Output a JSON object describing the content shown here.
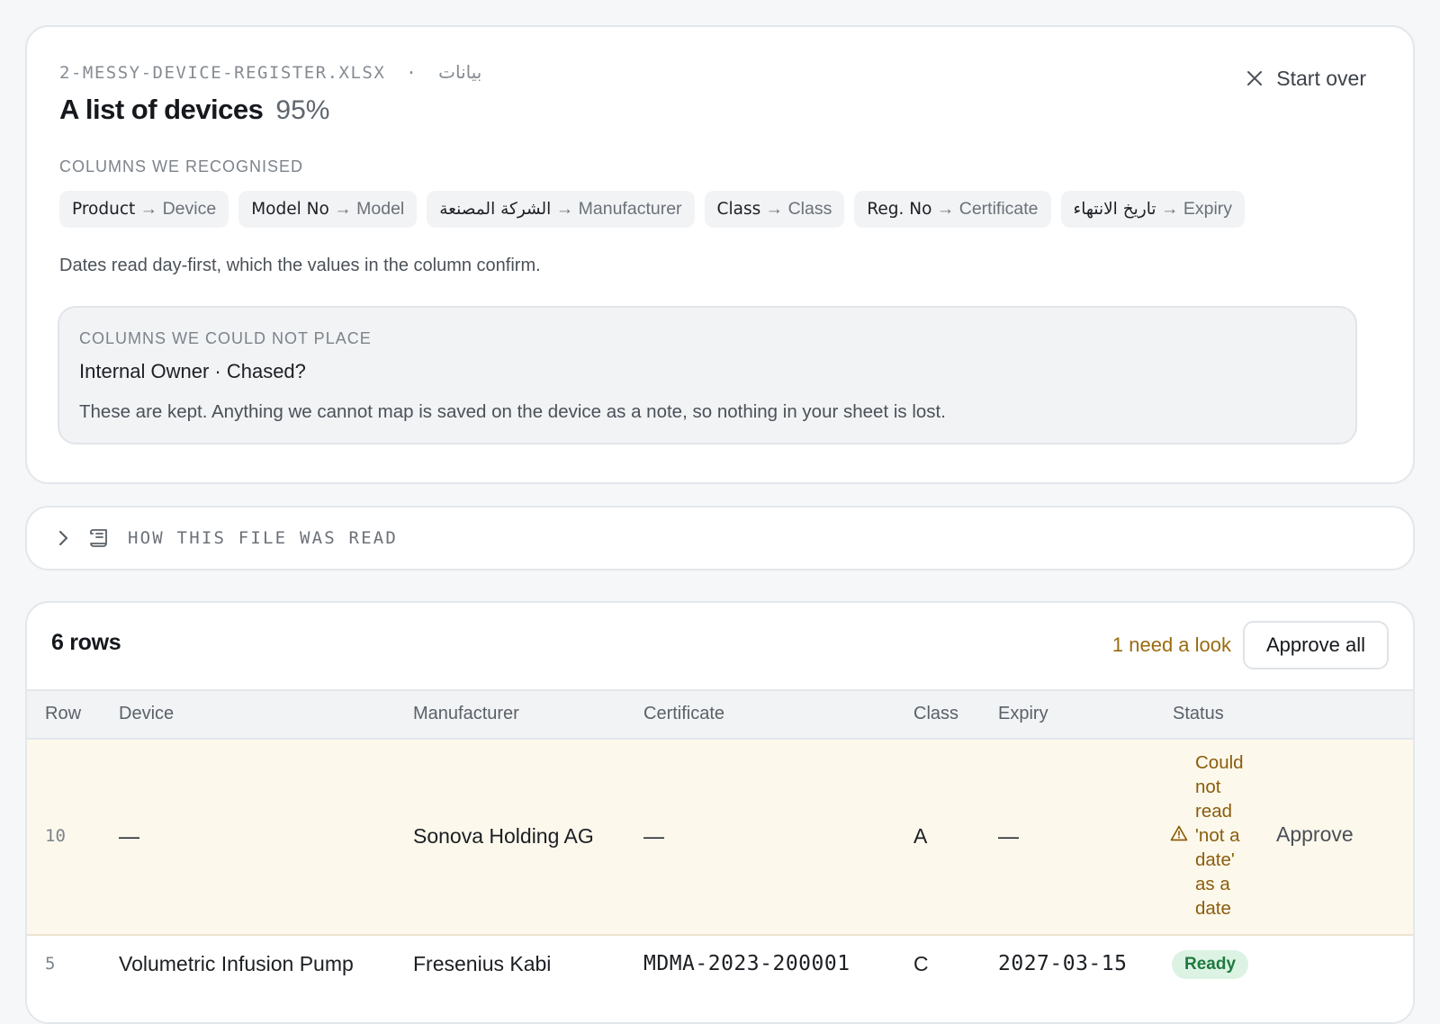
{
  "summary": {
    "file_name": "2-MESSY-DEVICE-REGISTER.XLSX",
    "separator": "·",
    "sheet_name": "بيانات",
    "title": "A list of devices",
    "confidence": "95%",
    "start_over_label": "Start over",
    "recognised_label": "COLUMNS WE RECOGNISED",
    "mappings": [
      {
        "source": "Product",
        "arrow": "→",
        "target": "Device"
      },
      {
        "source": "Model No",
        "arrow": "→",
        "target": "Model"
      },
      {
        "source": "الشركة المصنعة",
        "arrow": "→",
        "target": "Manufacturer"
      },
      {
        "source": "Class",
        "arrow": "→",
        "target": "Class"
      },
      {
        "source": "Reg. No",
        "arrow": "→",
        "target": "Certificate"
      },
      {
        "source": "تاريخ الانتهاء",
        "arrow": "→",
        "target": "Expiry"
      }
    ],
    "date_note": "Dates read day-first, which the values in the column confirm.",
    "unplaced_label": "COLUMNS WE COULD NOT PLACE",
    "unplaced_columns": "Internal Owner · Chased?",
    "unplaced_note": "These are kept. Anything we cannot map is saved on the device as a note, so nothing in your sheet is lost."
  },
  "how_read": {
    "label": "HOW THIS FILE WAS READ",
    "icons": {
      "toggle": "chevron-right-icon",
      "doc": "scroll-icon"
    }
  },
  "table": {
    "row_count": "6 rows",
    "need_look": "1 need a look",
    "approve_all_label": "Approve all",
    "headers": [
      "Row",
      "Device",
      "Manufacturer",
      "Certificate",
      "Class",
      "Expiry",
      "Status"
    ],
    "rows": [
      {
        "row": "10",
        "device": "—",
        "manufacturer": "Sonova Holding AG",
        "certificate": "—",
        "class": "A",
        "expiry": "—",
        "status": "Could not read 'not a date' as a date",
        "status_icon": "warning-icon",
        "action": "Approve"
      },
      {
        "row": "5",
        "device": "Volumetric Infusion Pump",
        "manufacturer": "Fresenius Kabi",
        "certificate": "MDMA-2023-200001",
        "class": "C",
        "expiry": "2027-03-15",
        "status": "Ready"
      }
    ]
  },
  "colors": {
    "warning_row_bg": "#fdf8ec",
    "warning_text": "#8a5d0c",
    "ready_badge_bg": "#dcf3e3",
    "ready_badge_text": "#1f7a40"
  }
}
